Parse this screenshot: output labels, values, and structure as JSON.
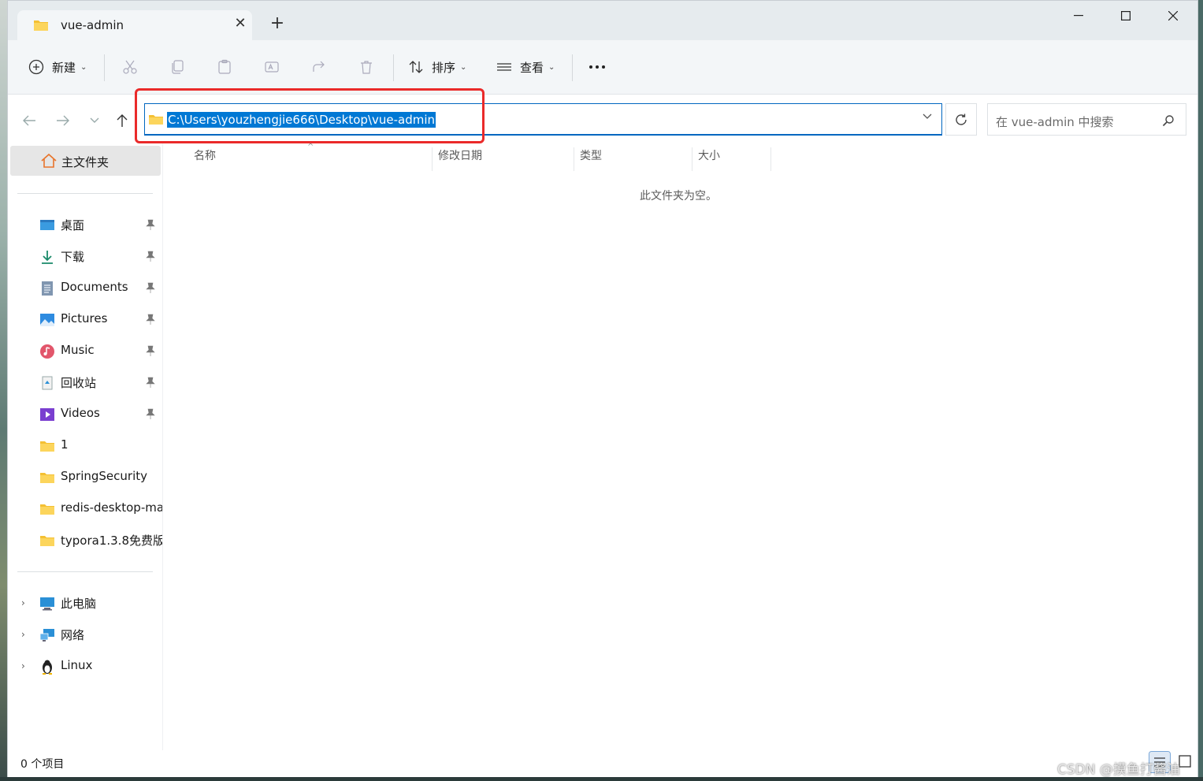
{
  "tab": {
    "title": "vue-admin",
    "close": "✕",
    "new_tab": "+"
  },
  "toolbar": {
    "new_label": "新建",
    "sort_label": "排序",
    "view_label": "查看",
    "more": "···"
  },
  "address": {
    "path": "C:\\Users\\youzhengjie666\\Desktop\\vue-admin"
  },
  "search": {
    "placeholder": "在 vue-admin 中搜索"
  },
  "sidebar": {
    "home": "主文件夹",
    "quick": [
      "桌面",
      "下载",
      "Documents",
      "Pictures",
      "Music",
      "回收站",
      "Videos",
      "1",
      "SpringSecurity",
      "redis-desktop-ma",
      "typora1.3.8免费版"
    ],
    "tree": [
      "此电脑",
      "网络",
      "Linux"
    ]
  },
  "columns": {
    "name": "名称",
    "modified": "修改日期",
    "type": "类型",
    "size": "大小"
  },
  "empty_message": "此文件夹为空。",
  "status": {
    "count": "0 个项目"
  },
  "watermark": "CSDN @摸鱼打酱油"
}
